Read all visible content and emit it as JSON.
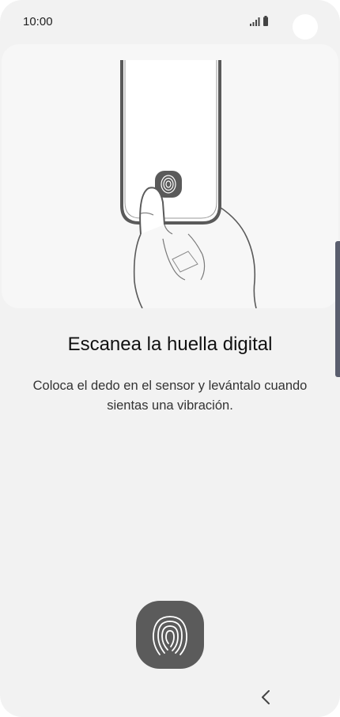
{
  "status_bar": {
    "time": "10:00",
    "icons": [
      "signal-icon",
      "battery-icon"
    ]
  },
  "illustration": {
    "icon": "phone-fingerprint-hand-illustration"
  },
  "content": {
    "title": "Escanea la huella digital",
    "description": "Coloca el dedo en el sensor y levántalo cuando sientas una vibración."
  },
  "fingerprint_button": {
    "icon": "fingerprint-icon"
  },
  "navigation": {
    "back_icon": "back-chevron-icon"
  },
  "colors": {
    "background": "#f2f2f2",
    "card": "#f7f7f7",
    "fingerprint_button": "#5b5b5b",
    "side_handle": "#5a5e6e"
  }
}
